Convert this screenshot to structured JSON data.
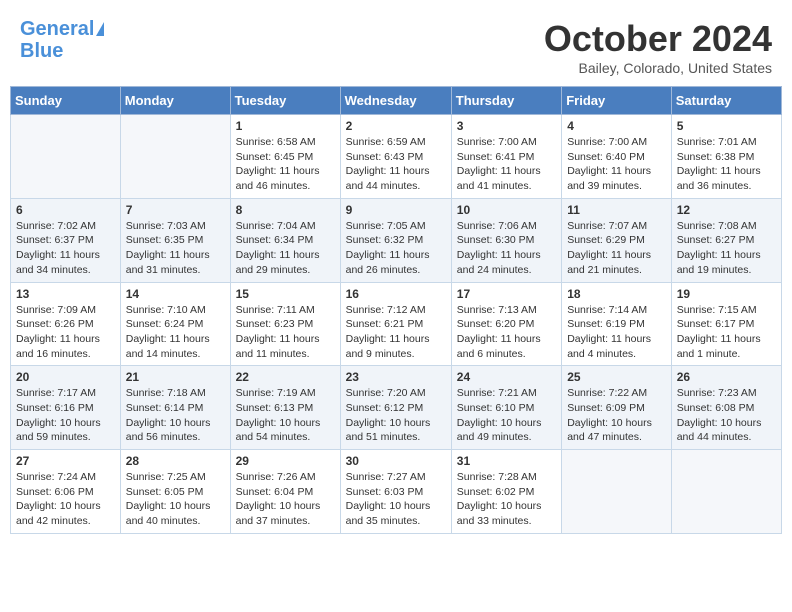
{
  "header": {
    "logo_line1": "General",
    "logo_line2": "Blue",
    "month": "October 2024",
    "location": "Bailey, Colorado, United States"
  },
  "weekdays": [
    "Sunday",
    "Monday",
    "Tuesday",
    "Wednesday",
    "Thursday",
    "Friday",
    "Saturday"
  ],
  "weeks": [
    [
      {
        "day": "",
        "sunrise": "",
        "sunset": "",
        "daylight": ""
      },
      {
        "day": "",
        "sunrise": "",
        "sunset": "",
        "daylight": ""
      },
      {
        "day": "1",
        "sunrise": "Sunrise: 6:58 AM",
        "sunset": "Sunset: 6:45 PM",
        "daylight": "Daylight: 11 hours and 46 minutes."
      },
      {
        "day": "2",
        "sunrise": "Sunrise: 6:59 AM",
        "sunset": "Sunset: 6:43 PM",
        "daylight": "Daylight: 11 hours and 44 minutes."
      },
      {
        "day": "3",
        "sunrise": "Sunrise: 7:00 AM",
        "sunset": "Sunset: 6:41 PM",
        "daylight": "Daylight: 11 hours and 41 minutes."
      },
      {
        "day": "4",
        "sunrise": "Sunrise: 7:00 AM",
        "sunset": "Sunset: 6:40 PM",
        "daylight": "Daylight: 11 hours and 39 minutes."
      },
      {
        "day": "5",
        "sunrise": "Sunrise: 7:01 AM",
        "sunset": "Sunset: 6:38 PM",
        "daylight": "Daylight: 11 hours and 36 minutes."
      }
    ],
    [
      {
        "day": "6",
        "sunrise": "Sunrise: 7:02 AM",
        "sunset": "Sunset: 6:37 PM",
        "daylight": "Daylight: 11 hours and 34 minutes."
      },
      {
        "day": "7",
        "sunrise": "Sunrise: 7:03 AM",
        "sunset": "Sunset: 6:35 PM",
        "daylight": "Daylight: 11 hours and 31 minutes."
      },
      {
        "day": "8",
        "sunrise": "Sunrise: 7:04 AM",
        "sunset": "Sunset: 6:34 PM",
        "daylight": "Daylight: 11 hours and 29 minutes."
      },
      {
        "day": "9",
        "sunrise": "Sunrise: 7:05 AM",
        "sunset": "Sunset: 6:32 PM",
        "daylight": "Daylight: 11 hours and 26 minutes."
      },
      {
        "day": "10",
        "sunrise": "Sunrise: 7:06 AM",
        "sunset": "Sunset: 6:30 PM",
        "daylight": "Daylight: 11 hours and 24 minutes."
      },
      {
        "day": "11",
        "sunrise": "Sunrise: 7:07 AM",
        "sunset": "Sunset: 6:29 PM",
        "daylight": "Daylight: 11 hours and 21 minutes."
      },
      {
        "day": "12",
        "sunrise": "Sunrise: 7:08 AM",
        "sunset": "Sunset: 6:27 PM",
        "daylight": "Daylight: 11 hours and 19 minutes."
      }
    ],
    [
      {
        "day": "13",
        "sunrise": "Sunrise: 7:09 AM",
        "sunset": "Sunset: 6:26 PM",
        "daylight": "Daylight: 11 hours and 16 minutes."
      },
      {
        "day": "14",
        "sunrise": "Sunrise: 7:10 AM",
        "sunset": "Sunset: 6:24 PM",
        "daylight": "Daylight: 11 hours and 14 minutes."
      },
      {
        "day": "15",
        "sunrise": "Sunrise: 7:11 AM",
        "sunset": "Sunset: 6:23 PM",
        "daylight": "Daylight: 11 hours and 11 minutes."
      },
      {
        "day": "16",
        "sunrise": "Sunrise: 7:12 AM",
        "sunset": "Sunset: 6:21 PM",
        "daylight": "Daylight: 11 hours and 9 minutes."
      },
      {
        "day": "17",
        "sunrise": "Sunrise: 7:13 AM",
        "sunset": "Sunset: 6:20 PM",
        "daylight": "Daylight: 11 hours and 6 minutes."
      },
      {
        "day": "18",
        "sunrise": "Sunrise: 7:14 AM",
        "sunset": "Sunset: 6:19 PM",
        "daylight": "Daylight: 11 hours and 4 minutes."
      },
      {
        "day": "19",
        "sunrise": "Sunrise: 7:15 AM",
        "sunset": "Sunset: 6:17 PM",
        "daylight": "Daylight: 11 hours and 1 minute."
      }
    ],
    [
      {
        "day": "20",
        "sunrise": "Sunrise: 7:17 AM",
        "sunset": "Sunset: 6:16 PM",
        "daylight": "Daylight: 10 hours and 59 minutes."
      },
      {
        "day": "21",
        "sunrise": "Sunrise: 7:18 AM",
        "sunset": "Sunset: 6:14 PM",
        "daylight": "Daylight: 10 hours and 56 minutes."
      },
      {
        "day": "22",
        "sunrise": "Sunrise: 7:19 AM",
        "sunset": "Sunset: 6:13 PM",
        "daylight": "Daylight: 10 hours and 54 minutes."
      },
      {
        "day": "23",
        "sunrise": "Sunrise: 7:20 AM",
        "sunset": "Sunset: 6:12 PM",
        "daylight": "Daylight: 10 hours and 51 minutes."
      },
      {
        "day": "24",
        "sunrise": "Sunrise: 7:21 AM",
        "sunset": "Sunset: 6:10 PM",
        "daylight": "Daylight: 10 hours and 49 minutes."
      },
      {
        "day": "25",
        "sunrise": "Sunrise: 7:22 AM",
        "sunset": "Sunset: 6:09 PM",
        "daylight": "Daylight: 10 hours and 47 minutes."
      },
      {
        "day": "26",
        "sunrise": "Sunrise: 7:23 AM",
        "sunset": "Sunset: 6:08 PM",
        "daylight": "Daylight: 10 hours and 44 minutes."
      }
    ],
    [
      {
        "day": "27",
        "sunrise": "Sunrise: 7:24 AM",
        "sunset": "Sunset: 6:06 PM",
        "daylight": "Daylight: 10 hours and 42 minutes."
      },
      {
        "day": "28",
        "sunrise": "Sunrise: 7:25 AM",
        "sunset": "Sunset: 6:05 PM",
        "daylight": "Daylight: 10 hours and 40 minutes."
      },
      {
        "day": "29",
        "sunrise": "Sunrise: 7:26 AM",
        "sunset": "Sunset: 6:04 PM",
        "daylight": "Daylight: 10 hours and 37 minutes."
      },
      {
        "day": "30",
        "sunrise": "Sunrise: 7:27 AM",
        "sunset": "Sunset: 6:03 PM",
        "daylight": "Daylight: 10 hours and 35 minutes."
      },
      {
        "day": "31",
        "sunrise": "Sunrise: 7:28 AM",
        "sunset": "Sunset: 6:02 PM",
        "daylight": "Daylight: 10 hours and 33 minutes."
      },
      {
        "day": "",
        "sunrise": "",
        "sunset": "",
        "daylight": ""
      },
      {
        "day": "",
        "sunrise": "",
        "sunset": "",
        "daylight": ""
      }
    ]
  ]
}
